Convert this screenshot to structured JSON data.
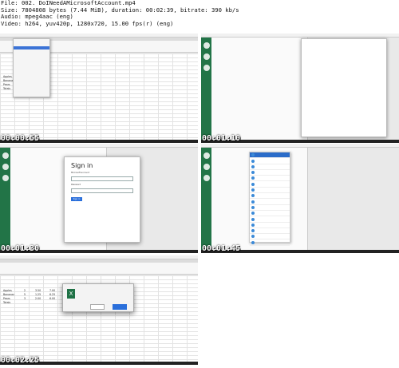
{
  "header": {
    "file": "File: 002. DoINeedAMicrosoftAccount.mp4",
    "size": "Size: 7804808 bytes (7.44 MiB), duration: 00:02:39, bitrate: 390 kb/s",
    "audio": "Audio: mpeg4aac (eng)",
    "video": "Video: h264, yuv420p, 1280x720, 15.00 fps(r) (eng)"
  },
  "thumbnails": [
    {
      "timestamp": "00:00:55",
      "scene": "excel-file-menu"
    },
    {
      "timestamp": "00:01:10",
      "scene": "blank-window"
    },
    {
      "timestamp": "00:01:30",
      "scene": "sign-in"
    },
    {
      "timestamp": "00:01:45",
      "scene": "account-list"
    },
    {
      "timestamp": "00:02:25",
      "scene": "excel-dialog"
    }
  ],
  "scene_text": {
    "signin_title": "Sign in",
    "signin_label": "Microsoft account",
    "password_label": "Password",
    "signin_button": "Sign in",
    "spreadsheet_rows": [
      "Apples",
      "Bananas",
      "Pears",
      "Totals"
    ],
    "spreadsheet_values": [
      "2",
      "5",
      "3",
      "3.50",
      "1.25",
      "2.00",
      "7.00",
      "6.25",
      "6.00"
    ]
  },
  "colors": {
    "accent": "#227447",
    "link": "#2a6fdb",
    "selection": "#3b73d6"
  }
}
